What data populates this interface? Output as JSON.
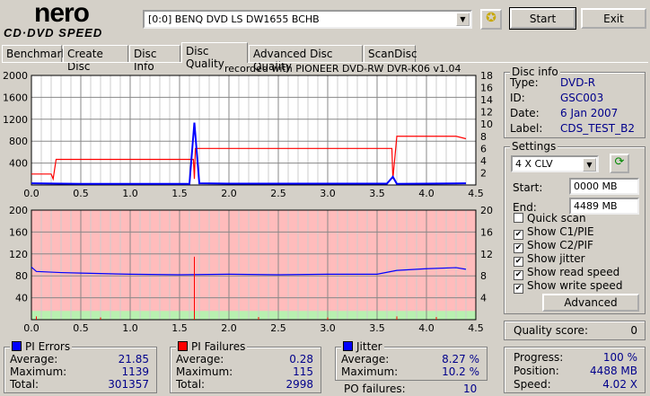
{
  "app": {
    "logo_top": "nero",
    "logo_bottom": "CD·DVD SPEED"
  },
  "toolbar": {
    "drive": "[0:0]  BENQ DVD LS DW1655 BCHB",
    "start": "Start",
    "exit": "Exit",
    "icon": "eject-settings-icon"
  },
  "tabs": [
    {
      "label": "Benchmark"
    },
    {
      "label": "Create Disc"
    },
    {
      "label": "Disc Info"
    },
    {
      "label": "Disc Quality",
      "active": true
    },
    {
      "label": "Advanced Disc Quality"
    },
    {
      "label": "ScanDisc"
    }
  ],
  "chart_caption": "recorded with PIONEER DVD-RW  DVR-K06  v1.04",
  "disc_info": {
    "title": "Disc info",
    "type_label": "Type:",
    "type": "DVD-R",
    "id_label": "ID:",
    "id": "GSC003",
    "date_label": "Date:",
    "date": "6 Jan 2007",
    "label_label": "Label:",
    "label": "CDS_TEST_B2"
  },
  "settings": {
    "title": "Settings",
    "speed": "4 X CLV",
    "start_label": "Start:",
    "start": "0000 MB",
    "end_label": "End:",
    "end": "4489 MB",
    "checks": [
      {
        "label": "Quick scan",
        "checked": false
      },
      {
        "label": "Show C1/PIE",
        "checked": true
      },
      {
        "label": "Show C2/PIF",
        "checked": true
      },
      {
        "label": "Show jitter",
        "checked": true
      },
      {
        "label": "Show read speed",
        "checked": true
      },
      {
        "label": "Show write speed",
        "checked": true
      }
    ],
    "advanced": "Advanced"
  },
  "quality": {
    "label": "Quality score:",
    "value": "0"
  },
  "progress": {
    "progress_label": "Progress:",
    "progress": "100 %",
    "position_label": "Position:",
    "position": "4488 MB",
    "speed_label": "Speed:",
    "speed": "4.02 X"
  },
  "pi_errors": {
    "title": "PI Errors",
    "color": "#0000ff",
    "avg_label": "Average:",
    "avg": "21.85",
    "max_label": "Maximum:",
    "max": "1139",
    "total_label": "Total:",
    "total": "301357"
  },
  "pi_failures": {
    "title": "PI Failures",
    "color": "#ff0000",
    "avg_label": "Average:",
    "avg": "0.28",
    "max_label": "Maximum:",
    "max": "115",
    "total_label": "Total:",
    "total": "2998"
  },
  "jitter": {
    "title": "Jitter",
    "color": "#0000ff",
    "avg_label": "Average:",
    "avg": "8.27 %",
    "max_label": "Maximum:",
    "max": "10.2 %",
    "po_label": "PO failures:",
    "po": "10"
  },
  "chart_data": [
    {
      "type": "line",
      "xlim": [
        0,
        4.5
      ],
      "ylim_left": [
        0,
        2000
      ],
      "ylim_right": [
        0,
        18
      ],
      "xticks": [
        "0.0",
        "0.5",
        "1.0",
        "1.5",
        "2.0",
        "2.5",
        "3.0",
        "3.5",
        "4.0",
        "4.5"
      ],
      "yticks_left": [
        "400",
        "800",
        "1200",
        "1600",
        "2000"
      ],
      "yticks_right": [
        "2",
        "4",
        "6",
        "8",
        "10",
        "12",
        "14",
        "16",
        "18"
      ],
      "series": [
        {
          "axis": "right",
          "color": "#ff0000",
          "x": [
            0,
            0.2,
            0.22,
            0.25,
            0.5,
            1.0,
            1.64,
            1.65,
            1.66,
            2.0,
            2.5,
            3.0,
            3.5,
            3.65,
            3.66,
            3.7,
            4.0,
            4.3,
            4.4
          ],
          "y": [
            1.8,
            1.8,
            1.0,
            4.2,
            4.2,
            4.2,
            4.2,
            1.0,
            6.0,
            6.0,
            6.0,
            6.0,
            6.0,
            6.0,
            1.0,
            8.0,
            8.0,
            8.0,
            7.6
          ]
        },
        {
          "axis": "left",
          "color": "#0000ff",
          "x": [
            0,
            0.5,
            1.0,
            1.6,
            1.65,
            1.7,
            2.0,
            3.0,
            3.6,
            3.66,
            3.7,
            4.0,
            4.4
          ],
          "y": [
            30,
            20,
            20,
            20,
            1139,
            30,
            25,
            25,
            25,
            150,
            20,
            25,
            30
          ]
        }
      ]
    },
    {
      "type": "line",
      "xlim": [
        0,
        4.5
      ],
      "ylim_left": [
        0,
        200
      ],
      "ylim_right": [
        0,
        20
      ],
      "xticks": [
        "0.0",
        "0.5",
        "1.0",
        "1.5",
        "2.0",
        "2.5",
        "3.0",
        "3.5",
        "4.0",
        "4.5"
      ],
      "yticks_left": [
        "40",
        "80",
        "120",
        "160",
        "200"
      ],
      "yticks_right": [
        "4",
        "8",
        "12",
        "16",
        "20"
      ],
      "series": [
        {
          "axis": "right",
          "color": "#0000ff",
          "x": [
            0,
            0.05,
            0.3,
            0.5,
            1.0,
            1.5,
            2.0,
            2.5,
            3.0,
            3.5,
            3.7,
            4.0,
            4.3,
            4.4
          ],
          "y": [
            9.6,
            8.8,
            8.6,
            8.5,
            8.3,
            8.2,
            8.3,
            8.2,
            8.3,
            8.3,
            9.0,
            9.3,
            9.5,
            9.2
          ]
        },
        {
          "axis": "left",
          "color": "#ff0000",
          "x": [
            0.05,
            0.7,
            1.65,
            2.3,
            3.0,
            3.7,
            4.1
          ],
          "y": [
            6,
            4,
            115,
            5,
            4,
            6,
            5
          ]
        }
      ]
    }
  ]
}
